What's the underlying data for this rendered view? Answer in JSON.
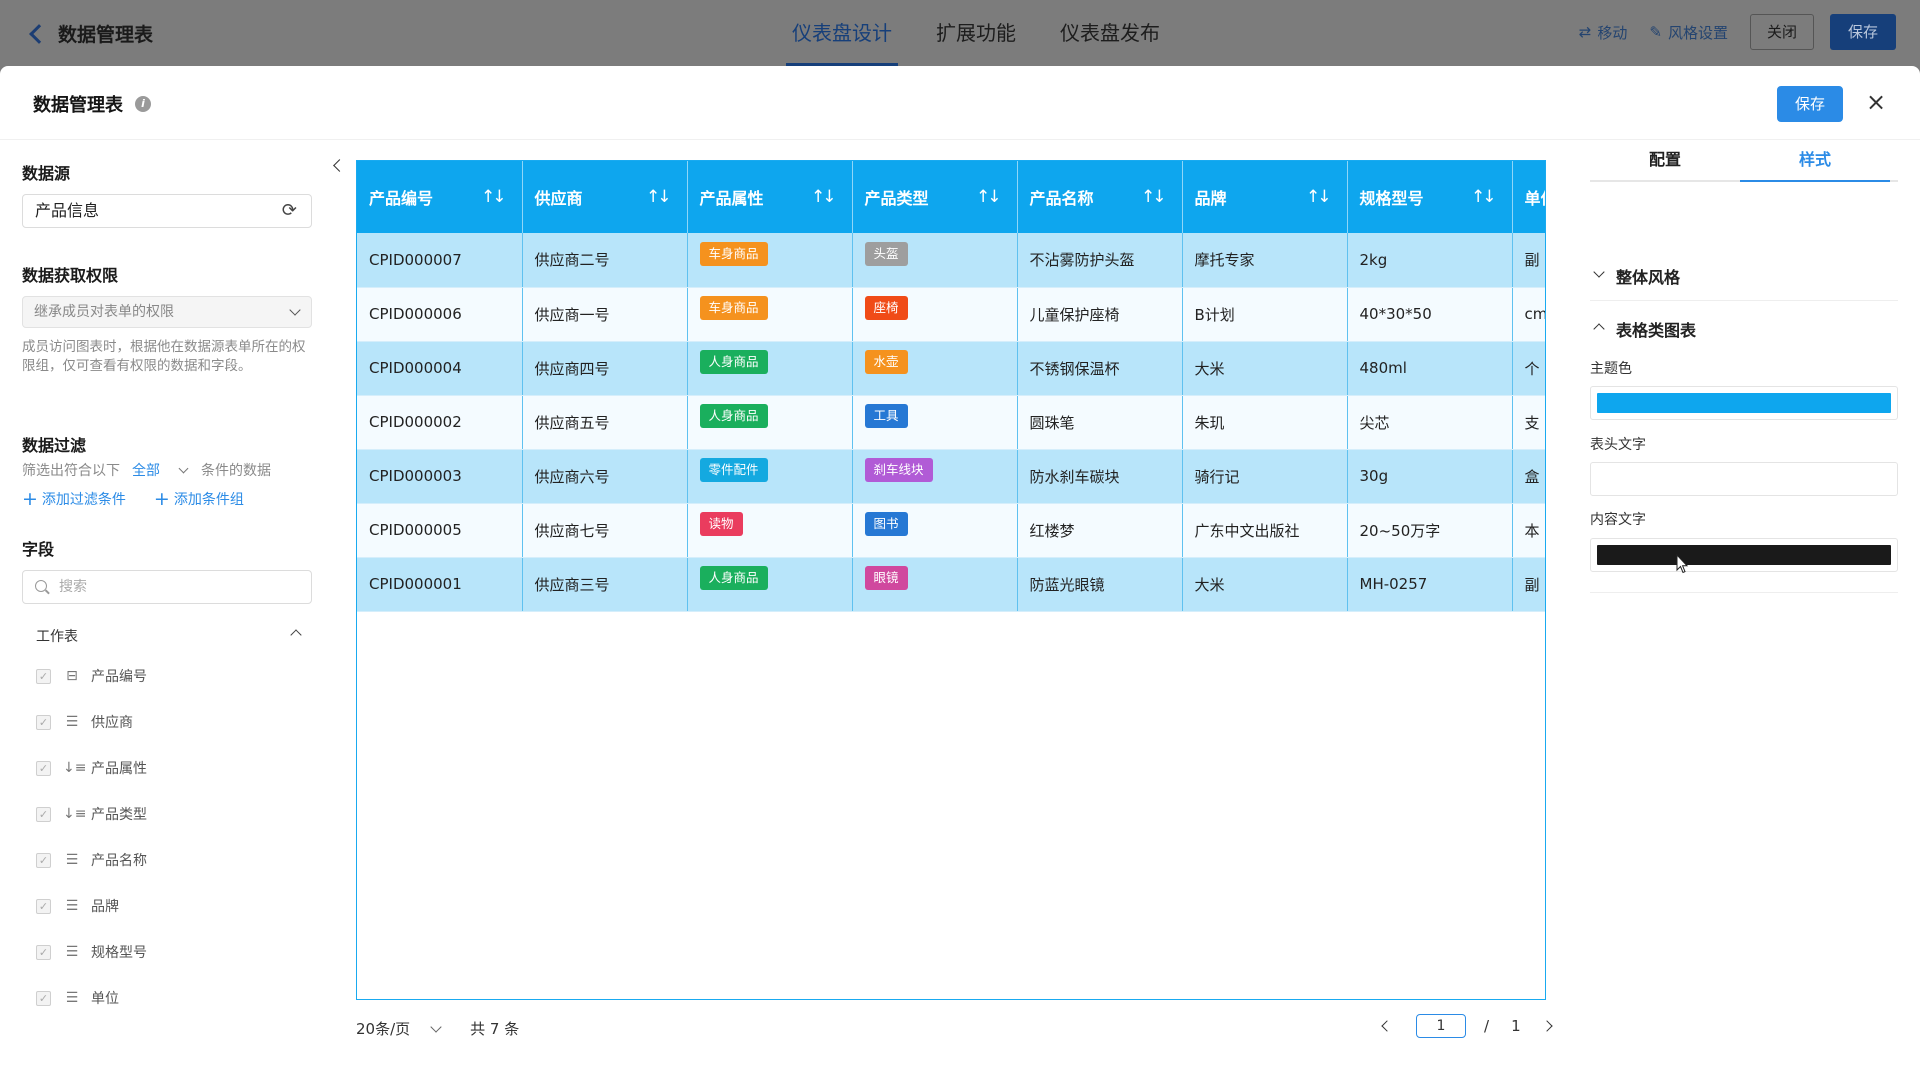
{
  "topbar": {
    "title": "数据管理表",
    "tabs": [
      "仪表盘设计",
      "扩展功能",
      "仪表盘发布"
    ],
    "move_label": "移动",
    "style_label": "风格设置",
    "close_label": "关闭",
    "save_label": "保存"
  },
  "modal": {
    "title": "数据管理表",
    "save_label": "保存"
  },
  "left": {
    "datasource_title": "数据源",
    "datasource_value": "产品信息",
    "permission_title": "数据获取权限",
    "permission_value": "继承成员对表单的权限",
    "permission_desc": "成员访问图表时，根据他在数据源表单所在的权限组，仅可查看有权限的数据和字段。",
    "filter_title": "数据过滤",
    "filter_prefix": "筛选出符合以下",
    "filter_mode": "全部",
    "filter_suffix": "条件的数据",
    "add_filter": "添加过滤条件",
    "add_group": "添加条件组",
    "fields_title": "字段",
    "search_placeholder": "搜索",
    "worksheet_label": "工作表",
    "fields": [
      {
        "name": "产品编号",
        "type_icon": "id-field-icon"
      },
      {
        "name": "供应商",
        "type_icon": "text-field-icon"
      },
      {
        "name": "产品属性",
        "type_icon": "sort-field-icon"
      },
      {
        "name": "产品类型",
        "type_icon": "sort-field-icon"
      },
      {
        "name": "产品名称",
        "type_icon": "text-field-icon"
      },
      {
        "name": "品牌",
        "type_icon": "text-field-icon"
      },
      {
        "name": "规格型号",
        "type_icon": "text-field-icon"
      },
      {
        "name": "单位",
        "type_icon": "text-field-icon"
      }
    ]
  },
  "table": {
    "headers": [
      "产品编号",
      "供应商",
      "产品属性",
      "产品类型",
      "产品名称",
      "品牌",
      "规格型号",
      "单位"
    ],
    "rows": [
      {
        "id": "CPID000007",
        "supplier": "供应商二号",
        "attr": "车身商品",
        "attr_color": "#f5921e",
        "type": "头盔",
        "type_color": "#9e9e9e",
        "name": "不沾雾防护头盔",
        "brand": "摩托专家",
        "spec": "2kg",
        "unit": "副"
      },
      {
        "id": "CPID000006",
        "supplier": "供应商一号",
        "attr": "车身商品",
        "attr_color": "#f5921e",
        "type": "座椅",
        "type_color": "#f04b17",
        "name": "儿童保护座椅",
        "brand": "B计划",
        "spec": "40*30*50",
        "unit": "cm"
      },
      {
        "id": "CPID000004",
        "supplier": "供应商四号",
        "attr": "人身商品",
        "attr_color": "#1aaf5d",
        "type": "水壶",
        "type_color": "#f5921e",
        "name": "不锈钢保温杯",
        "brand": "大米",
        "spec": "480ml",
        "unit": "个"
      },
      {
        "id": "CPID000002",
        "supplier": "供应商五号",
        "attr": "人身商品",
        "attr_color": "#1aaf5d",
        "type": "工具",
        "type_color": "#2678d4",
        "name": "圆珠笔",
        "brand": "朱玑",
        "spec": "尖芯",
        "unit": "支"
      },
      {
        "id": "CPID000003",
        "supplier": "供应商六号",
        "attr": "零件配件",
        "attr_color": "#14a9e0",
        "type": "刹车线块",
        "type_color": "#b15bd6",
        "name": "防水刹车碳块",
        "brand": "骑行记",
        "spec": "30g",
        "unit": "盒"
      },
      {
        "id": "CPID000005",
        "supplier": "供应商七号",
        "attr": "读物",
        "attr_color": "#ea3c5e",
        "type": "图书",
        "type_color": "#2678d4",
        "name": "红楼梦",
        "brand": "广东中文出版社",
        "spec": "20~50万字",
        "unit": "本"
      },
      {
        "id": "CPID000001",
        "supplier": "供应商三号",
        "attr": "人身商品",
        "attr_color": "#1aaf5d",
        "type": "眼镜",
        "type_color": "#d0489e",
        "name": "防蓝光眼镜",
        "brand": "大米",
        "spec": "MH-0257",
        "unit": "副"
      }
    ]
  },
  "pager": {
    "page_size": "20条/页",
    "total": "共 7 条",
    "current": "1",
    "slash": "/",
    "pages": "1"
  },
  "right": {
    "tabs": [
      "配置",
      "样式"
    ],
    "section_overall": "整体风格",
    "section_table": "表格类图表",
    "theme_label": "主题色",
    "theme_color": "#0ea6ee",
    "header_text_label": "表头文字",
    "header_text_color": "#ffffff",
    "content_text_label": "内容文字",
    "content_text_color": "#1a1a1a"
  }
}
